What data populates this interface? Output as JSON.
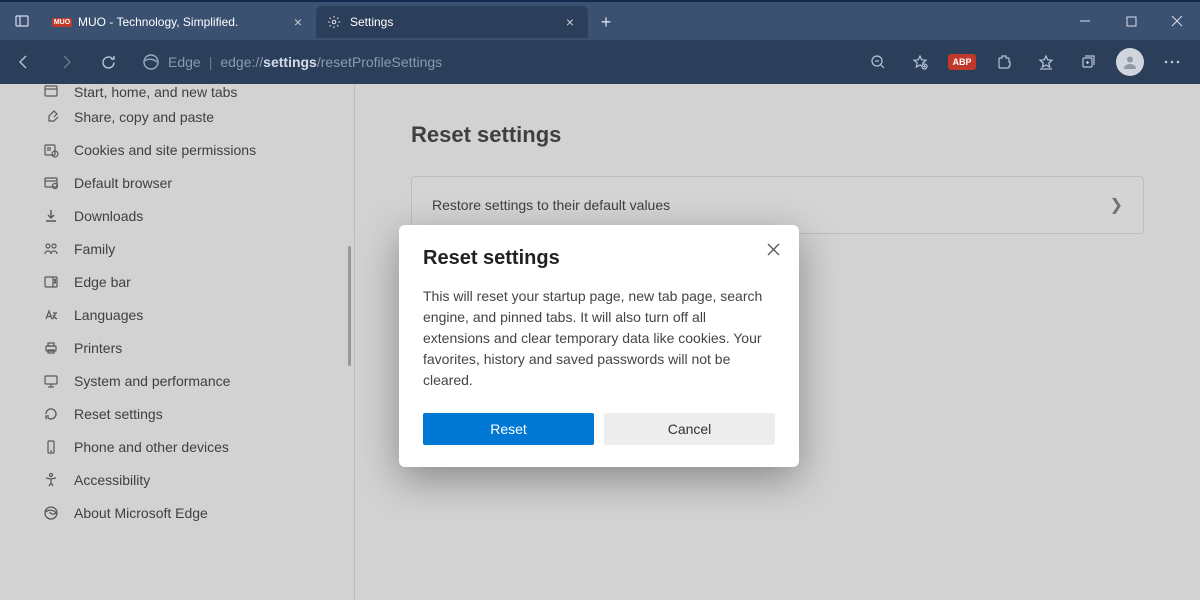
{
  "titlebar": {
    "tabs": [
      {
        "title": "MUO - Technology, Simplified.",
        "favicon": "MUO"
      },
      {
        "title": "Settings",
        "favicon": "gear"
      }
    ]
  },
  "toolbar": {
    "addr_prefix": "Edge",
    "addr_protocol": "edge://",
    "addr_bold": "settings",
    "addr_rest": "/resetProfileSettings",
    "abp": "ABP"
  },
  "sidebar": {
    "items": [
      {
        "label": "Start, home, and new tabs",
        "icon": "home"
      },
      {
        "label": "Share, copy and paste",
        "icon": "share"
      },
      {
        "label": "Cookies and site permissions",
        "icon": "cookie"
      },
      {
        "label": "Default browser",
        "icon": "browser"
      },
      {
        "label": "Downloads",
        "icon": "download"
      },
      {
        "label": "Family",
        "icon": "family"
      },
      {
        "label": "Edge bar",
        "icon": "edgebar"
      },
      {
        "label": "Languages",
        "icon": "language"
      },
      {
        "label": "Printers",
        "icon": "printer"
      },
      {
        "label": "System and performance",
        "icon": "system"
      },
      {
        "label": "Reset settings",
        "icon": "reset"
      },
      {
        "label": "Phone and other devices",
        "icon": "phone"
      },
      {
        "label": "Accessibility",
        "icon": "accessibility"
      },
      {
        "label": "About Microsoft Edge",
        "icon": "edge"
      }
    ]
  },
  "main": {
    "title": "Reset settings",
    "row_label": "Restore settings to their default values"
  },
  "dialog": {
    "title": "Reset settings",
    "body": "This will reset your startup page, new tab page, search engine, and pinned tabs. It will also turn off all extensions and clear temporary data like cookies. Your favorites, history and saved passwords will not be cleared.",
    "reset": "Reset",
    "cancel": "Cancel"
  }
}
